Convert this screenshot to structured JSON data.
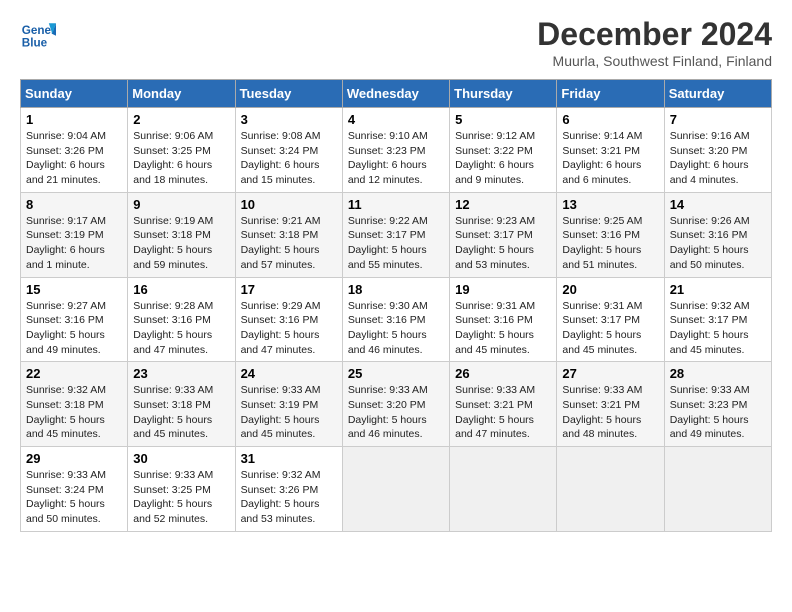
{
  "header": {
    "logo_line1": "General",
    "logo_line2": "Blue",
    "title": "December 2024",
    "subtitle": "Muurla, Southwest Finland, Finland"
  },
  "calendar": {
    "days_of_week": [
      "Sunday",
      "Monday",
      "Tuesday",
      "Wednesday",
      "Thursday",
      "Friday",
      "Saturday"
    ],
    "weeks": [
      [
        {
          "day": "1",
          "info": "Sunrise: 9:04 AM\nSunset: 3:26 PM\nDaylight: 6 hours\nand 21 minutes."
        },
        {
          "day": "2",
          "info": "Sunrise: 9:06 AM\nSunset: 3:25 PM\nDaylight: 6 hours\nand 18 minutes."
        },
        {
          "day": "3",
          "info": "Sunrise: 9:08 AM\nSunset: 3:24 PM\nDaylight: 6 hours\nand 15 minutes."
        },
        {
          "day": "4",
          "info": "Sunrise: 9:10 AM\nSunset: 3:23 PM\nDaylight: 6 hours\nand 12 minutes."
        },
        {
          "day": "5",
          "info": "Sunrise: 9:12 AM\nSunset: 3:22 PM\nDaylight: 6 hours\nand 9 minutes."
        },
        {
          "day": "6",
          "info": "Sunrise: 9:14 AM\nSunset: 3:21 PM\nDaylight: 6 hours\nand 6 minutes."
        },
        {
          "day": "7",
          "info": "Sunrise: 9:16 AM\nSunset: 3:20 PM\nDaylight: 6 hours\nand 4 minutes."
        }
      ],
      [
        {
          "day": "8",
          "info": "Sunrise: 9:17 AM\nSunset: 3:19 PM\nDaylight: 6 hours\nand 1 minute."
        },
        {
          "day": "9",
          "info": "Sunrise: 9:19 AM\nSunset: 3:18 PM\nDaylight: 5 hours\nand 59 minutes."
        },
        {
          "day": "10",
          "info": "Sunrise: 9:21 AM\nSunset: 3:18 PM\nDaylight: 5 hours\nand 57 minutes."
        },
        {
          "day": "11",
          "info": "Sunrise: 9:22 AM\nSunset: 3:17 PM\nDaylight: 5 hours\nand 55 minutes."
        },
        {
          "day": "12",
          "info": "Sunrise: 9:23 AM\nSunset: 3:17 PM\nDaylight: 5 hours\nand 53 minutes."
        },
        {
          "day": "13",
          "info": "Sunrise: 9:25 AM\nSunset: 3:16 PM\nDaylight: 5 hours\nand 51 minutes."
        },
        {
          "day": "14",
          "info": "Sunrise: 9:26 AM\nSunset: 3:16 PM\nDaylight: 5 hours\nand 50 minutes."
        }
      ],
      [
        {
          "day": "15",
          "info": "Sunrise: 9:27 AM\nSunset: 3:16 PM\nDaylight: 5 hours\nand 49 minutes."
        },
        {
          "day": "16",
          "info": "Sunrise: 9:28 AM\nSunset: 3:16 PM\nDaylight: 5 hours\nand 47 minutes."
        },
        {
          "day": "17",
          "info": "Sunrise: 9:29 AM\nSunset: 3:16 PM\nDaylight: 5 hours\nand 47 minutes."
        },
        {
          "day": "18",
          "info": "Sunrise: 9:30 AM\nSunset: 3:16 PM\nDaylight: 5 hours\nand 46 minutes."
        },
        {
          "day": "19",
          "info": "Sunrise: 9:31 AM\nSunset: 3:16 PM\nDaylight: 5 hours\nand 45 minutes."
        },
        {
          "day": "20",
          "info": "Sunrise: 9:31 AM\nSunset: 3:17 PM\nDaylight: 5 hours\nand 45 minutes."
        },
        {
          "day": "21",
          "info": "Sunrise: 9:32 AM\nSunset: 3:17 PM\nDaylight: 5 hours\nand 45 minutes."
        }
      ],
      [
        {
          "day": "22",
          "info": "Sunrise: 9:32 AM\nSunset: 3:18 PM\nDaylight: 5 hours\nand 45 minutes."
        },
        {
          "day": "23",
          "info": "Sunrise: 9:33 AM\nSunset: 3:18 PM\nDaylight: 5 hours\nand 45 minutes."
        },
        {
          "day": "24",
          "info": "Sunrise: 9:33 AM\nSunset: 3:19 PM\nDaylight: 5 hours\nand 45 minutes."
        },
        {
          "day": "25",
          "info": "Sunrise: 9:33 AM\nSunset: 3:20 PM\nDaylight: 5 hours\nand 46 minutes."
        },
        {
          "day": "26",
          "info": "Sunrise: 9:33 AM\nSunset: 3:21 PM\nDaylight: 5 hours\nand 47 minutes."
        },
        {
          "day": "27",
          "info": "Sunrise: 9:33 AM\nSunset: 3:21 PM\nDaylight: 5 hours\nand 48 minutes."
        },
        {
          "day": "28",
          "info": "Sunrise: 9:33 AM\nSunset: 3:23 PM\nDaylight: 5 hours\nand 49 minutes."
        }
      ],
      [
        {
          "day": "29",
          "info": "Sunrise: 9:33 AM\nSunset: 3:24 PM\nDaylight: 5 hours\nand 50 minutes."
        },
        {
          "day": "30",
          "info": "Sunrise: 9:33 AM\nSunset: 3:25 PM\nDaylight: 5 hours\nand 52 minutes."
        },
        {
          "day": "31",
          "info": "Sunrise: 9:32 AM\nSunset: 3:26 PM\nDaylight: 5 hours\nand 53 minutes."
        },
        null,
        null,
        null,
        null
      ]
    ]
  }
}
